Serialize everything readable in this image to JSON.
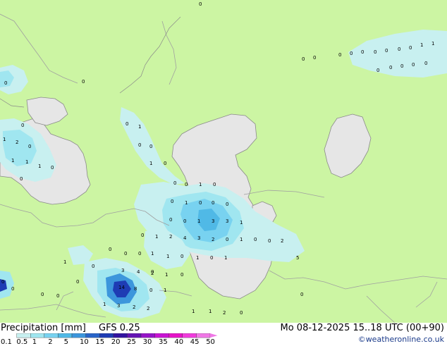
{
  "footer": {
    "title": "Precipitation [mm]",
    "model": "GFS 0.25",
    "datetime": "Mo 08-12-2025 15..18 UTC (00+90)",
    "credit": "©weatheronline.co.uk"
  },
  "legend": {
    "labels": [
      "0.1",
      "0.5",
      "1",
      "2",
      "5",
      "10",
      "15",
      "20",
      "25",
      "30",
      "35",
      "40",
      "45",
      "50"
    ],
    "colors": [
      "#c8f0f0",
      "#a0e6f0",
      "#78d2f0",
      "#50b9e6",
      "#3c96dc",
      "#2864c8",
      "#1e3cb4",
      "#3214a0",
      "#6414b4",
      "#9614c8",
      "#c814d2",
      "#e614c8",
      "#f03cdc",
      "#f078e6"
    ]
  },
  "map": {
    "land_color": "#ccf5a3",
    "water_color": "#e6e6e6",
    "border_color": "#a0a0a0",
    "coast_color": "#8a8a8a",
    "precip_light_color": "#c8f0f0",
    "precip_medium_color": "#a0e6f0",
    "precip_heavy_color": "#78d2f0",
    "precip_intense_color": "#3c96dc",
    "precip_extreme_color": "#1e3cb4",
    "values": [
      "0",
      "0",
      "0",
      "0",
      "0",
      "0",
      "0",
      "0",
      "1",
      "1",
      "0",
      "0",
      "0",
      "1",
      "0",
      "0",
      "0",
      "0",
      "0",
      "0",
      "1",
      "2",
      "0",
      "1",
      "1",
      "1",
      "0",
      "0",
      "1",
      "0",
      "0",
      "0",
      "1",
      "0",
      "0",
      "1",
      "0",
      "0",
      "0",
      "0",
      "0",
      "1",
      "3",
      "3",
      "1",
      "0",
      "1",
      "2",
      "4",
      "3",
      "2",
      "0",
      "1",
      "0",
      "0",
      "2",
      "5",
      "0",
      "0",
      "0",
      "1",
      "1",
      "0",
      "1",
      "0",
      "1",
      "1",
      "0",
      "0",
      "0",
      "0",
      "0",
      "0",
      "0",
      "3",
      "4",
      "2",
      "1",
      "0",
      "14",
      "8",
      "0",
      "1",
      "1",
      "3",
      "2",
      "2",
      "1",
      "1",
      "2",
      "0",
      "0",
      "0",
      "0",
      "0",
      "0"
    ]
  }
}
